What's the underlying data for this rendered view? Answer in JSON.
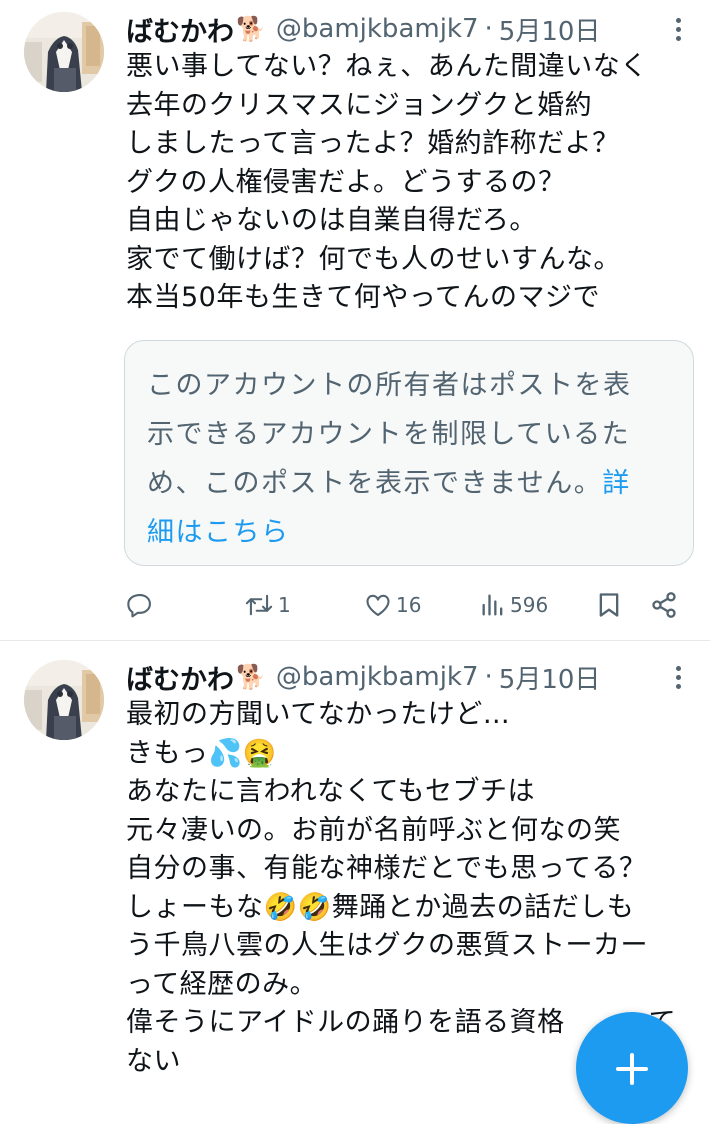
{
  "tweets": [
    {
      "author_name": "ばむかわ",
      "author_emoji": "🐕",
      "handle": "@bamjkbamjk7",
      "separator": "·",
      "date": "5月10日",
      "lines": [
        "悪い事してない？ねぇ、あんた間違いなく",
        "去年のクリスマスにジョングクと婚約",
        "しましたって言ったよ？婚約詐称だよ？",
        "グクの人権侵害だよ。どうするの？",
        "自由じゃないのは自業自得だろ。",
        "家でて働けば？何でも人のせいすんな。",
        "本当50年も生きて何やってんのマジで"
      ],
      "quote": {
        "lines": [
          "このアカウントの所有者はポストを表",
          "示できるアカウントを制限しているた",
          "め、このポストを表示できません。"
        ],
        "link_line1": "詳",
        "link_line2": "細はこちら"
      },
      "actions": {
        "replies": "",
        "reposts": "1",
        "likes": "16",
        "views": "596"
      }
    },
    {
      "author_name": "ばむかわ",
      "author_emoji": "🐕",
      "handle": "@bamjkbamjk7",
      "separator": "·",
      "date": "5月10日",
      "lines": [
        "最初の方聞いてなかったけど…",
        "きもっ💦🤮",
        "あなたに言われなくてもセブチは",
        "元々凄いの。お前が名前呼ぶと何なの笑",
        "自分の事、有能な神様だとでも思ってる？",
        "しょーもな🤣🤣舞踊とか過去の話だしも",
        "う千鳥八雲の人生はグクの悪質ストーカー",
        "って経歴のみ。",
        "偉そうにアイドルの踊りを語る資格",
        "ない"
      ],
      "line9_tail": "て"
    }
  ],
  "colors": {
    "accent": "#1d9bf0",
    "muted": "#536471",
    "text": "#0f1419",
    "border": "#cfd9de"
  },
  "icons": [
    "more-icon",
    "reply-icon",
    "repost-icon",
    "like-icon",
    "views-icon",
    "bookmark-icon",
    "share-icon",
    "compose-plus-icon"
  ]
}
